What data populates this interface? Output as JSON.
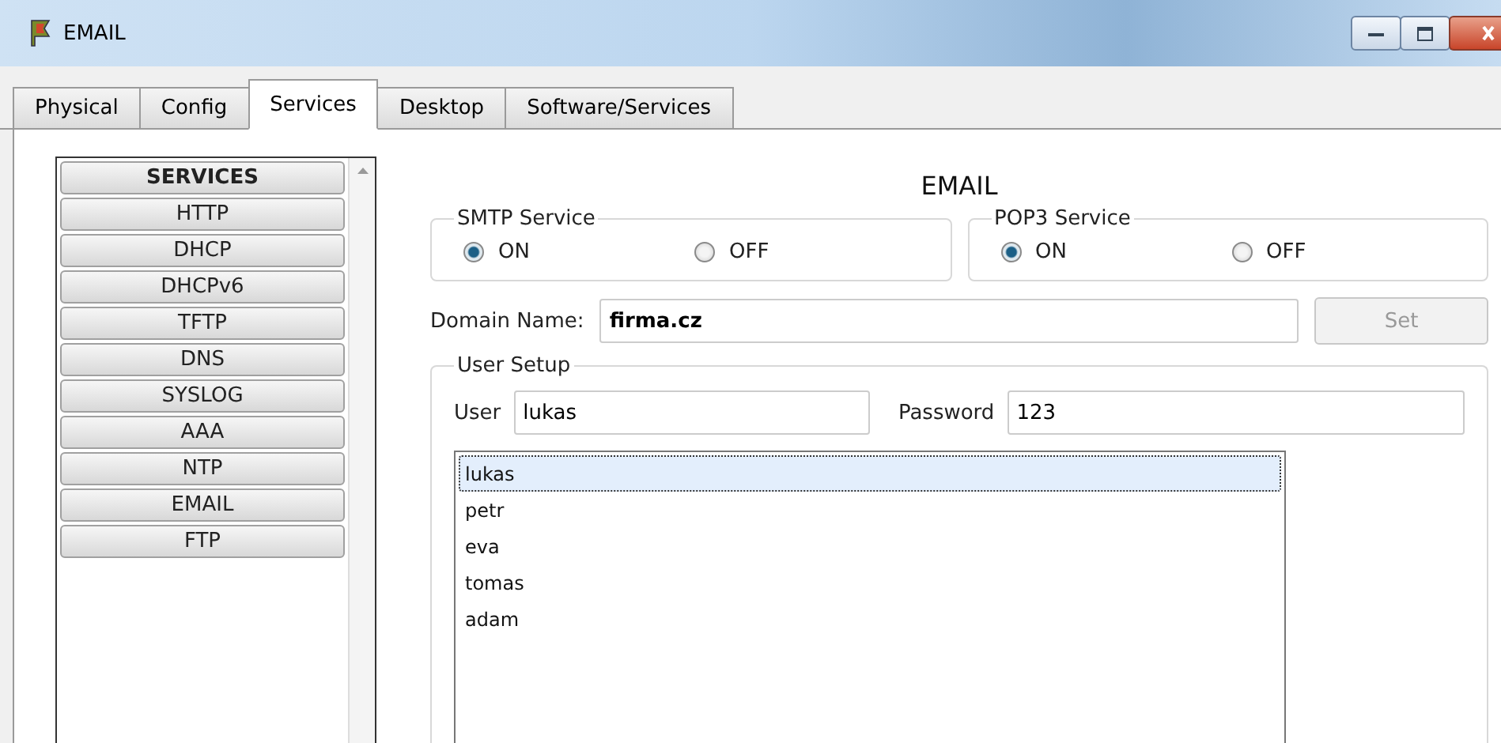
{
  "window": {
    "title": "EMAIL"
  },
  "tabs": [
    {
      "label": "Physical",
      "selected": false
    },
    {
      "label": "Config",
      "selected": false
    },
    {
      "label": "Services",
      "selected": true
    },
    {
      "label": "Desktop",
      "selected": false
    },
    {
      "label": "Software/Services",
      "selected": false
    }
  ],
  "sidebar": {
    "header": "SERVICES",
    "items": [
      {
        "label": "HTTP"
      },
      {
        "label": "DHCP"
      },
      {
        "label": "DHCPv6"
      },
      {
        "label": "TFTP"
      },
      {
        "label": "DNS"
      },
      {
        "label": "SYSLOG"
      },
      {
        "label": "AAA"
      },
      {
        "label": "NTP"
      },
      {
        "label": "EMAIL"
      },
      {
        "label": "FTP"
      }
    ]
  },
  "panel_title": "EMAIL",
  "services": [
    {
      "title": "SMTP Service",
      "options": [
        {
          "label": "ON",
          "selected": true
        },
        {
          "label": "OFF",
          "selected": false
        }
      ]
    },
    {
      "title": "POP3 Service",
      "options": [
        {
          "label": "ON",
          "selected": true
        },
        {
          "label": "OFF",
          "selected": false
        }
      ]
    }
  ],
  "domain": {
    "label": "Domain Name:",
    "value": "firma.cz",
    "button": {
      "label": "Set",
      "disabled": true
    }
  },
  "user_setup": {
    "title": "User Setup",
    "user_label": "User",
    "user_value": "lukas",
    "password_label": "Password",
    "password_value": "123",
    "users": [
      {
        "name": "lukas",
        "selected": true
      },
      {
        "name": "petr",
        "selected": false
      },
      {
        "name": "eva",
        "selected": false
      },
      {
        "name": "tomas",
        "selected": false
      },
      {
        "name": "adam",
        "selected": false
      }
    ]
  }
}
